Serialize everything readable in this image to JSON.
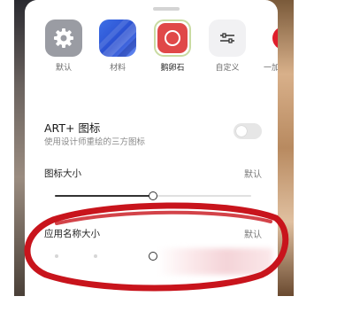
{
  "icon_styles": [
    {
      "label": "默认",
      "icon": "gear-icon",
      "selected": false
    },
    {
      "label": "材料",
      "icon": "material-icon",
      "selected": false
    },
    {
      "label": "鹅卵石",
      "icon": "pebble-icon",
      "selected": true
    },
    {
      "label": "自定义",
      "icon": "sliders-icon",
      "selected": false
    },
    {
      "label": "一加图标",
      "icon": "oneplus-icon",
      "selected": false
    }
  ],
  "art_plus": {
    "title": "ART+ 图标",
    "subtitle": "使用设计师重绘的三方图标",
    "enabled": false
  },
  "icon_size": {
    "label": "图标大小",
    "value_label": "默认",
    "level": 0.5
  },
  "app_name_size": {
    "label": "应用名称大小",
    "value_label": "默认",
    "level": 0.5
  },
  "colors": {
    "accent_red": "#e04848",
    "annotation_red": "#c8141c",
    "slider_dark": "#333333"
  }
}
